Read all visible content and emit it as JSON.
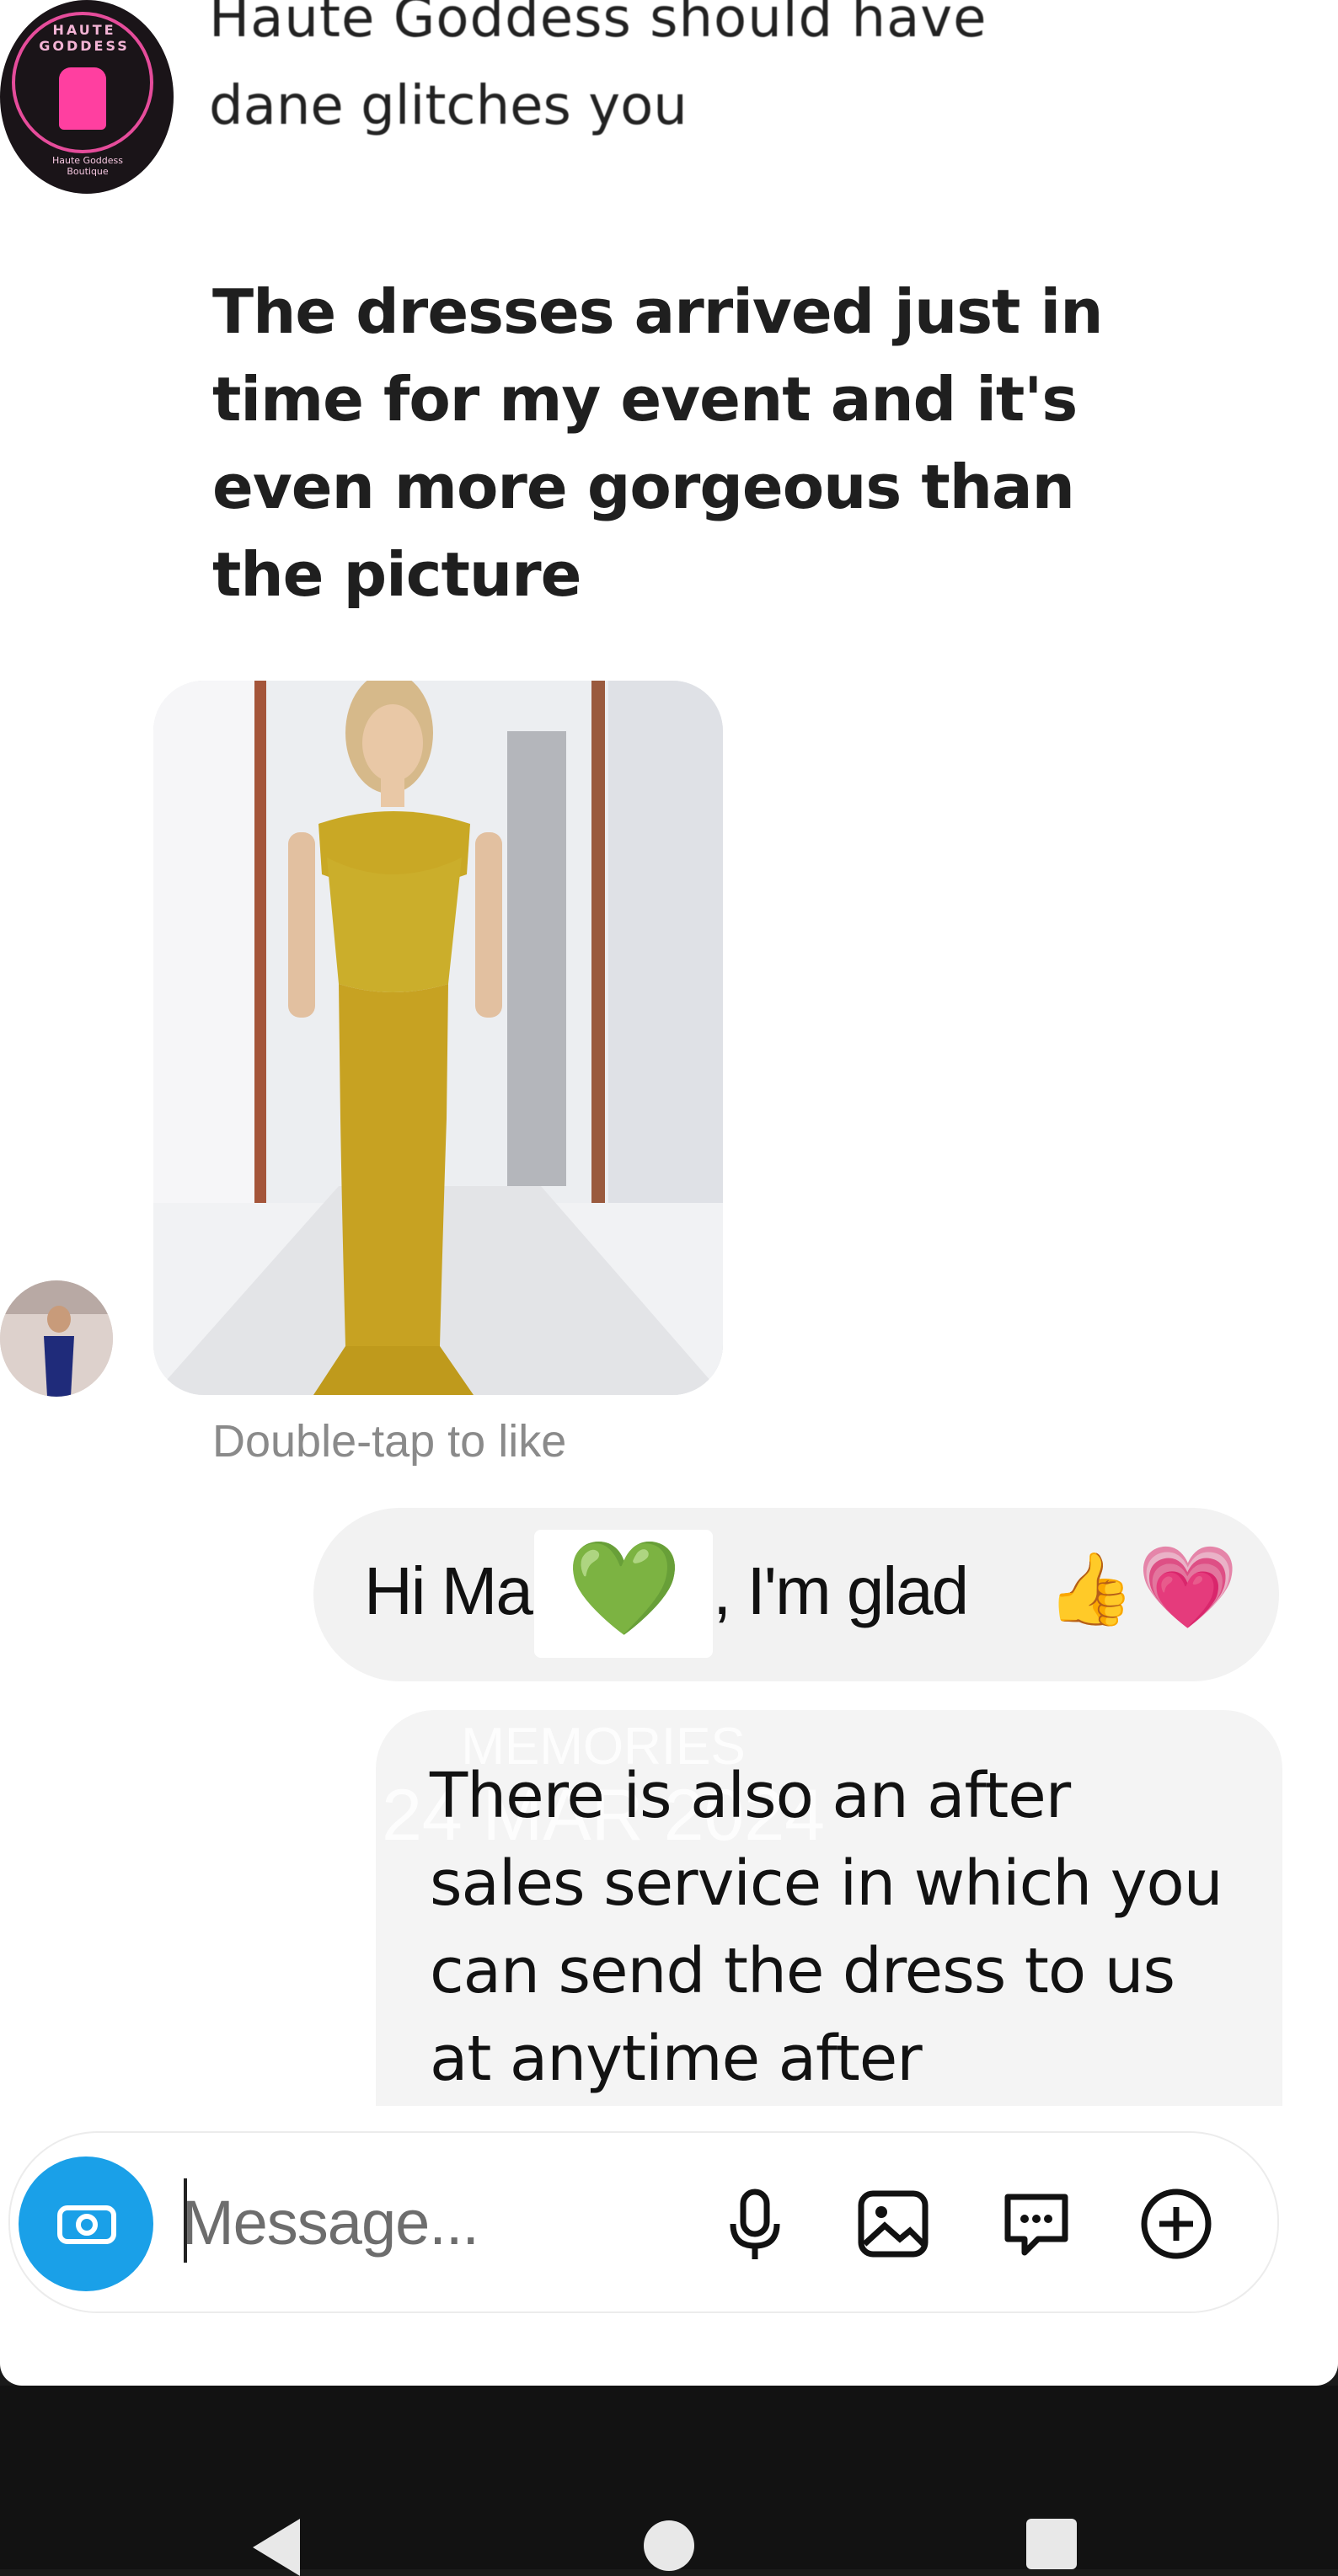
{
  "header": {
    "partial_line_1": "Haute Goddess should have",
    "partial_line_2": "dane glitches you",
    "brand_badge_text": "HAUTE GODDESS",
    "brand_badge_sub": "Haute Goddess Boutique"
  },
  "thread": {
    "incoming_message": "The dresses arrived just in time for my event and it's even more gorgeous than the picture",
    "photo_alt": "Customer photo in gold gown",
    "double_tap_hint": "Double-tap to like",
    "outgoing_1": {
      "before_emoji": "Hi Ma",
      "after_emoji": ", I'm glad",
      "emoji_green_heart": "💚",
      "emoji_thumbs": "👍",
      "emoji_pink_heart": "💗"
    },
    "outgoing_2": {
      "text": "There is also an after sales service in which you can send the dress to us at anytime after",
      "watermark_line_1": "MEMORIES",
      "watermark_line_2": "24 MAR 2024"
    }
  },
  "composer": {
    "placeholder": "Message...",
    "icons": [
      "camera-icon",
      "microphone-icon",
      "image-icon",
      "sticker-icon",
      "plus-icon"
    ]
  },
  "system_nav": {
    "icons": [
      "back-icon",
      "home-icon",
      "recents-icon"
    ]
  },
  "colors": {
    "camera_blue": "#1aa0e8",
    "bubble_gray": "#f2f2f2",
    "brand_pink": "#ff3fa0"
  }
}
